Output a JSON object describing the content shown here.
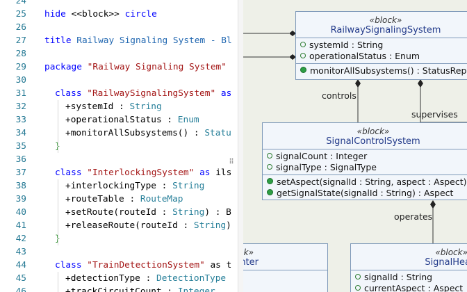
{
  "editor": {
    "line_numbers": [
      "24",
      "25",
      "26",
      "27",
      "28",
      "29",
      "30",
      "31",
      "32",
      "33",
      "34",
      "35",
      "36",
      "37",
      "38",
      "39",
      "40",
      "41",
      "42",
      "43",
      "44",
      "45",
      "46"
    ],
    "lines": {
      "l25": {
        "kw1": "hide",
        "t1": " <<block>> ",
        "kw2": "circle"
      },
      "l27": {
        "kw1": "title",
        "t1": " ",
        "title": "Railway Signaling System - Bl"
      },
      "l29": {
        "kw1": "package",
        "t1": " ",
        "str": "\"Railway Signaling System\""
      },
      "l31": {
        "kw1": "class",
        "t1": " ",
        "str": "\"RailwaySignalingSystem\"",
        "t2": " ",
        "kw2": "as"
      },
      "l32": {
        "t1": "+systemId : ",
        "typ": "String"
      },
      "l33": {
        "t1": "+operationalStatus : ",
        "typ": "Enum"
      },
      "l34": {
        "t1": "+monitorAllSubsystems() : ",
        "typ": "Statu"
      },
      "l35": {
        "brace": "}"
      },
      "l37": {
        "kw1": "class",
        "t1": " ",
        "str": "\"InterlockingSystem\"",
        "t2": " ",
        "kw2": "as",
        "t3": " ils"
      },
      "l38": {
        "t1": "+interlockingType : ",
        "typ": "String"
      },
      "l39": {
        "t1": "+routeTable : ",
        "typ": "RouteMap"
      },
      "l40": {
        "t1": "+setRoute(routeId : ",
        "typ": "String",
        "t2": ") : B"
      },
      "l41": {
        "t1": "+releaseRoute(routeId : ",
        "typ": "String",
        "t2": ")"
      },
      "l42": {
        "brace": "}"
      },
      "l44": {
        "kw1": "class",
        "t1": " ",
        "str": "\"TrainDetectionSystem\"",
        "t2": " as t"
      },
      "l45": {
        "t1": "+detectionType : ",
        "typ": "DetectionType"
      },
      "l46": {
        "t1": "+trackCircuitCount : ",
        "typ": "Integer"
      }
    }
  },
  "diagram": {
    "rss": {
      "stereotype": "«block»",
      "name": "RailwaySignalingSystem",
      "attrs": [
        "systemId : String",
        "operationalStatus : Enum"
      ],
      "ops": [
        "monitorAllSubsystems() : StatusRep"
      ]
    },
    "scs": {
      "stereotype": "«block»",
      "name": "SignalControlSystem",
      "attrs": [
        "signalCount : Integer",
        "signalType : SignalType"
      ],
      "ops": [
        "setAspect(signalId : String, aspect : Aspect)",
        "getSignalState(signalId : String) : Aspect"
      ]
    },
    "left_box": {
      "stereotype": "k»",
      "name": "unter"
    },
    "right_box": {
      "stereotype": "«block»",
      "name": "SignalHea",
      "attrs": [
        "signalId : String",
        "currentAspect : Aspect"
      ]
    },
    "labels": {
      "controls": "controls",
      "supervises": "supervises",
      "operates": "operates"
    },
    "colors": {
      "background": "#eef0e8",
      "box_fill": "#f2f6fb",
      "box_border": "#7d98b8",
      "name_color": "#223a8a"
    }
  }
}
